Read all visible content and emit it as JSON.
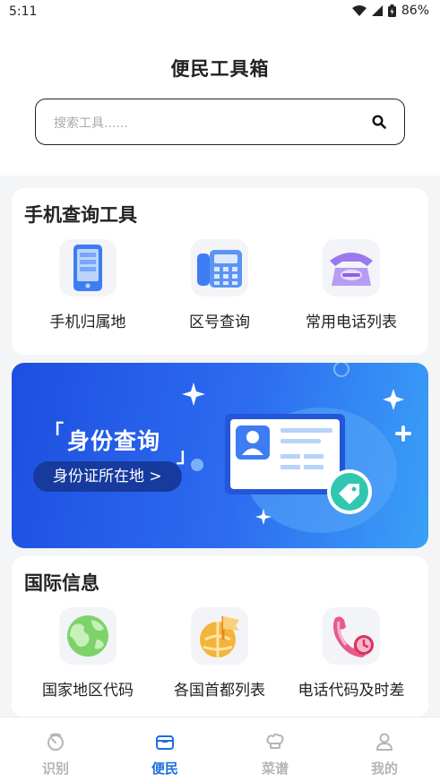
{
  "status": {
    "time": "5:11",
    "battery": "86%"
  },
  "header": {
    "title": "便民工具箱"
  },
  "search": {
    "placeholder": "搜索工具......"
  },
  "phone_tools": {
    "title": "手机查询工具",
    "items": [
      {
        "label": "手机归属地",
        "icon": "phone-icon"
      },
      {
        "label": "区号查询",
        "icon": "fax-icon"
      },
      {
        "label": "常用电话列表",
        "icon": "telephone-icon"
      }
    ]
  },
  "banner": {
    "title": "身份查询",
    "button": "身份证所在地 >"
  },
  "intl": {
    "title": "国际信息",
    "items": [
      {
        "label": "国家地区代码",
        "icon": "globe-icon"
      },
      {
        "label": "各国首都列表",
        "icon": "flag-globe-icon"
      },
      {
        "label": "电话代码及时差",
        "icon": "phone-clock-icon"
      }
    ]
  },
  "tabbar": {
    "items": [
      {
        "label": "识别"
      },
      {
        "label": "便民"
      },
      {
        "label": "菜谱"
      },
      {
        "label": "我的"
      }
    ],
    "active_index": 1
  },
  "colors": {
    "accent": "#1d6fe0",
    "banner": "#2d6cf0"
  }
}
